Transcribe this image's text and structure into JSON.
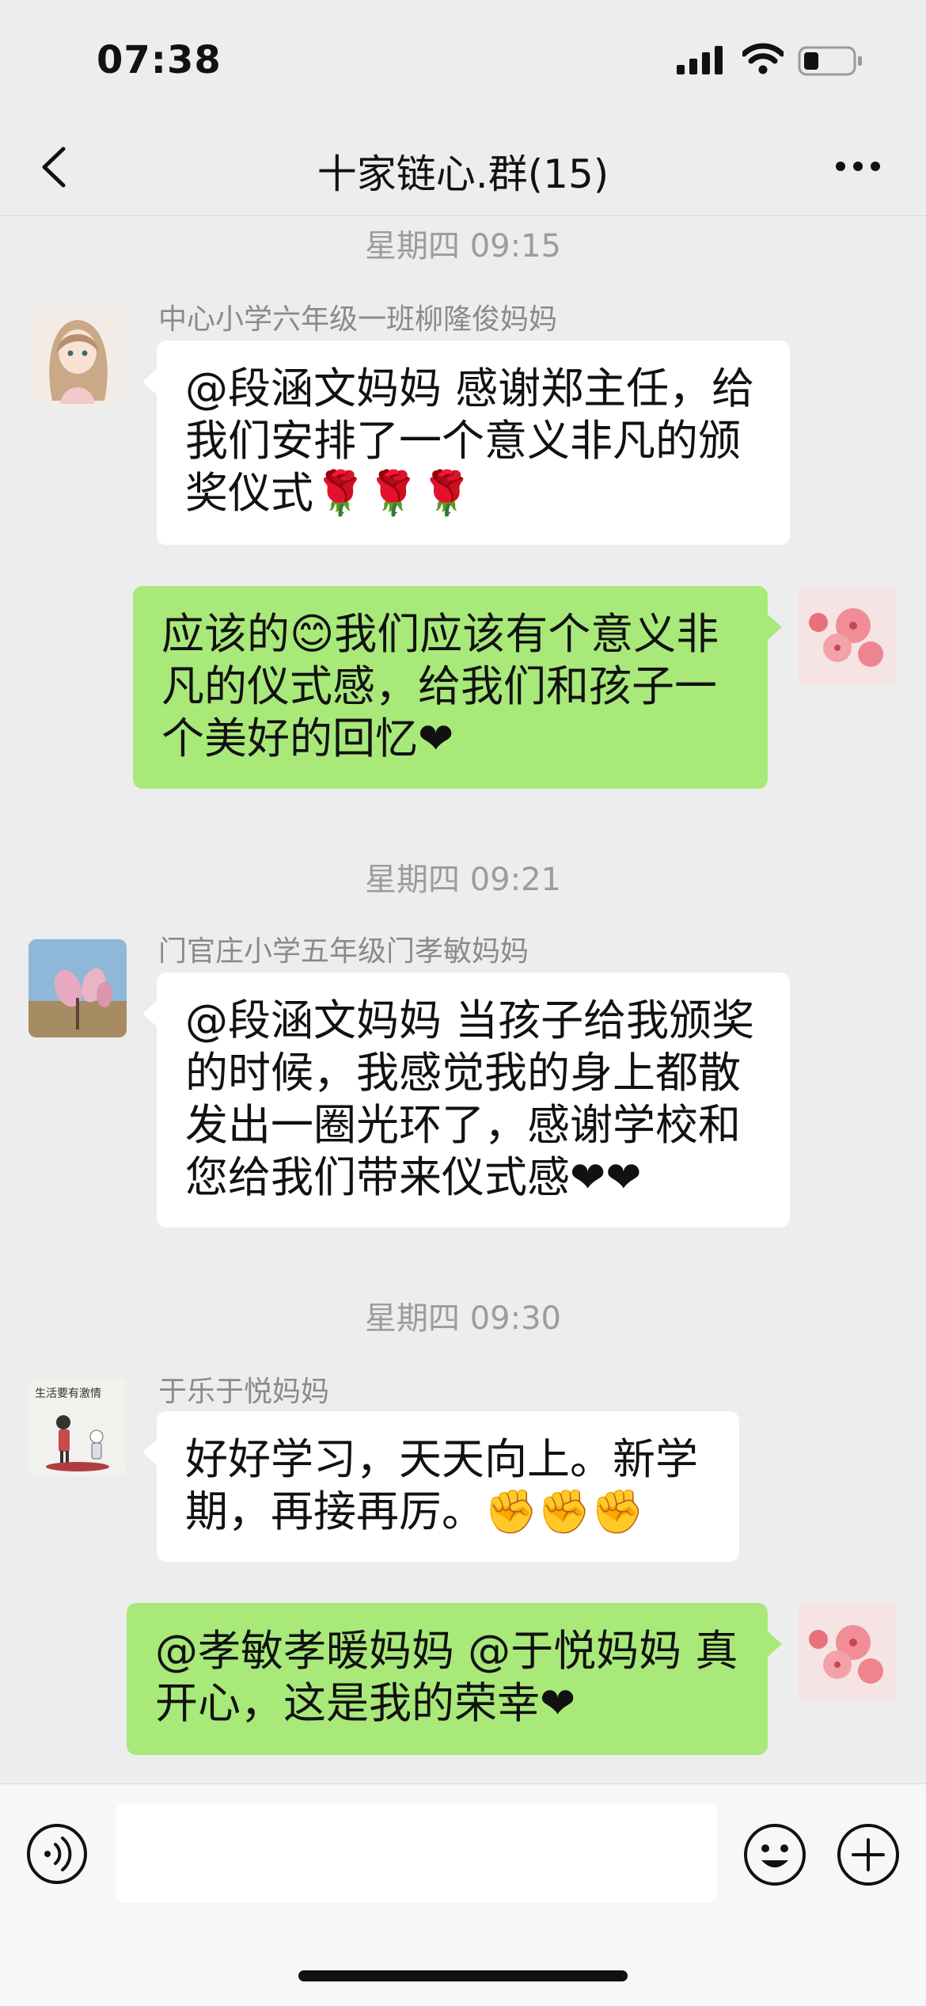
{
  "status_bar": {
    "time": "07:38"
  },
  "header": {
    "title": "十家链心.群(15)"
  },
  "messages": [
    {
      "timestamp": "星期四 09:15",
      "sender": "中心小学六年级一班柳隆俊妈妈",
      "text": "@段涵文妈妈 感谢郑主任，给我们安排了一个意义非凡的颁奖仪式🌹🌹🌹"
    },
    {
      "text": "应该的😊我们应该有个意义非凡的仪式感，给我们和孩子一个美好的回忆❤"
    },
    {
      "timestamp": "星期四 09:21",
      "sender": "门官庄小学五年级门孝敏妈妈",
      "text": "@段涵文妈妈 当孩子给我颁奖的时候，我感觉我的身上都散发出一圈光环了，感谢学校和您给我们带来仪式感❤❤"
    },
    {
      "timestamp": "星期四 09:30",
      "sender": "于乐于悦妈妈",
      "avatar_text": "生活要有激情",
      "text": "好好学习，天天向上。新学期，再接再厉。✊✊✊"
    },
    {
      "text": "@孝敏孝暖妈妈 @于悦妈妈 真开心，这是我的荣幸❤"
    }
  ],
  "colors": {
    "outgoing_bubble": "#a9e97a",
    "incoming_bubble": "#ffffff",
    "background": "#ededed"
  },
  "icons": [
    "back-chevron-icon",
    "more-dots-icon",
    "voice-icon",
    "emoji-icon",
    "plus-icon"
  ]
}
